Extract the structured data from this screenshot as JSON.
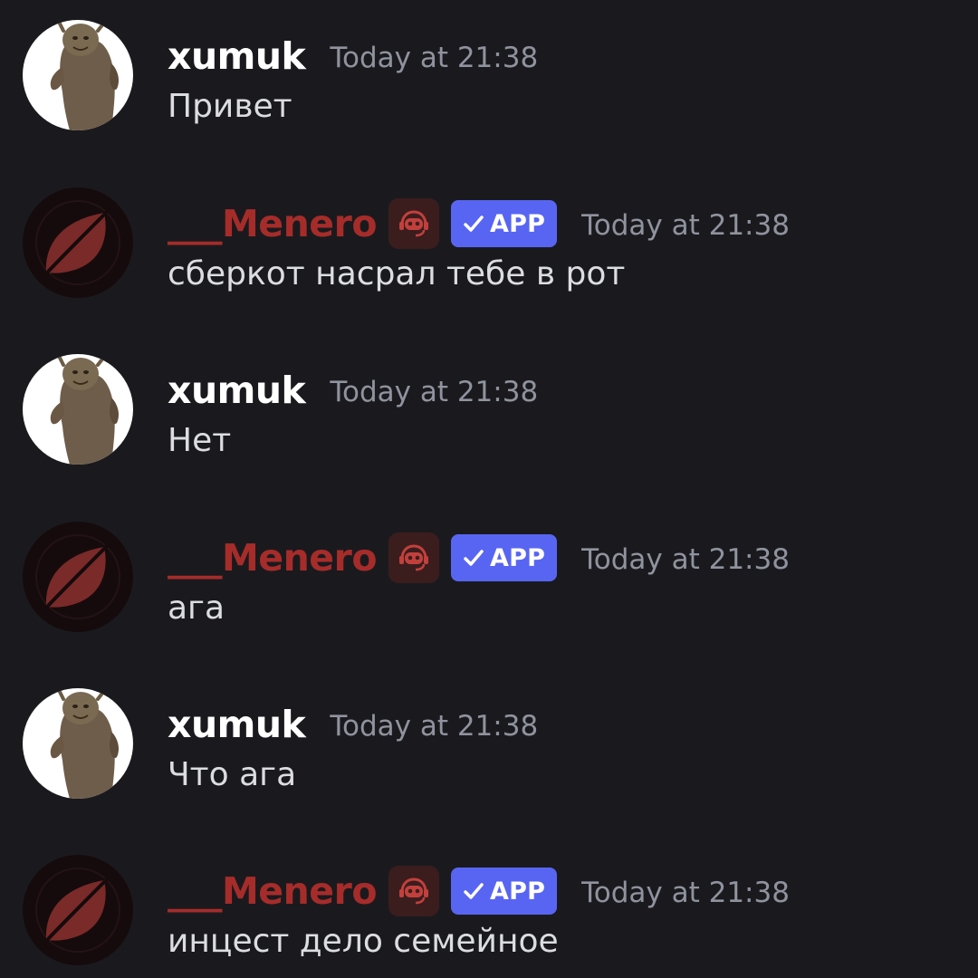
{
  "colors": {
    "background": "#1a1a1e",
    "user_name": "#ffffff",
    "bot_name": "#a62c2a",
    "bot_icon_bg": "#3b1d1e",
    "app_badge": "#5865f2",
    "timestamp": "#8f939e",
    "message_text": "#dcdde1"
  },
  "messages": [
    {
      "username": "xumuk",
      "is_app": false,
      "avatar_icon": "shrek-dancing-avatar",
      "timestamp": "Today at 21:38",
      "text": "Привет"
    },
    {
      "username": "___Menero",
      "is_app": true,
      "avatar_icon": "red-leaf-avatar",
      "bot_icon": "robot-headset-icon",
      "app_label": "APP",
      "timestamp": "Today at 21:38",
      "text": "сберкот насрал тебе в рот"
    },
    {
      "username": "xumuk",
      "is_app": false,
      "avatar_icon": "shrek-dancing-avatar",
      "timestamp": "Today at 21:38",
      "text": "Нет"
    },
    {
      "username": "___Menero",
      "is_app": true,
      "avatar_icon": "red-leaf-avatar",
      "bot_icon": "robot-headset-icon",
      "app_label": "APP",
      "timestamp": "Today at 21:38",
      "text": "ага"
    },
    {
      "username": "xumuk",
      "is_app": false,
      "avatar_icon": "shrek-dancing-avatar",
      "timestamp": "Today at 21:38",
      "text": "Что ага"
    },
    {
      "username": "___Menero",
      "is_app": true,
      "avatar_icon": "red-leaf-avatar",
      "bot_icon": "robot-headset-icon",
      "app_label": "APP",
      "timestamp": "Today at 21:38",
      "text": "инцест дело семейное"
    }
  ]
}
